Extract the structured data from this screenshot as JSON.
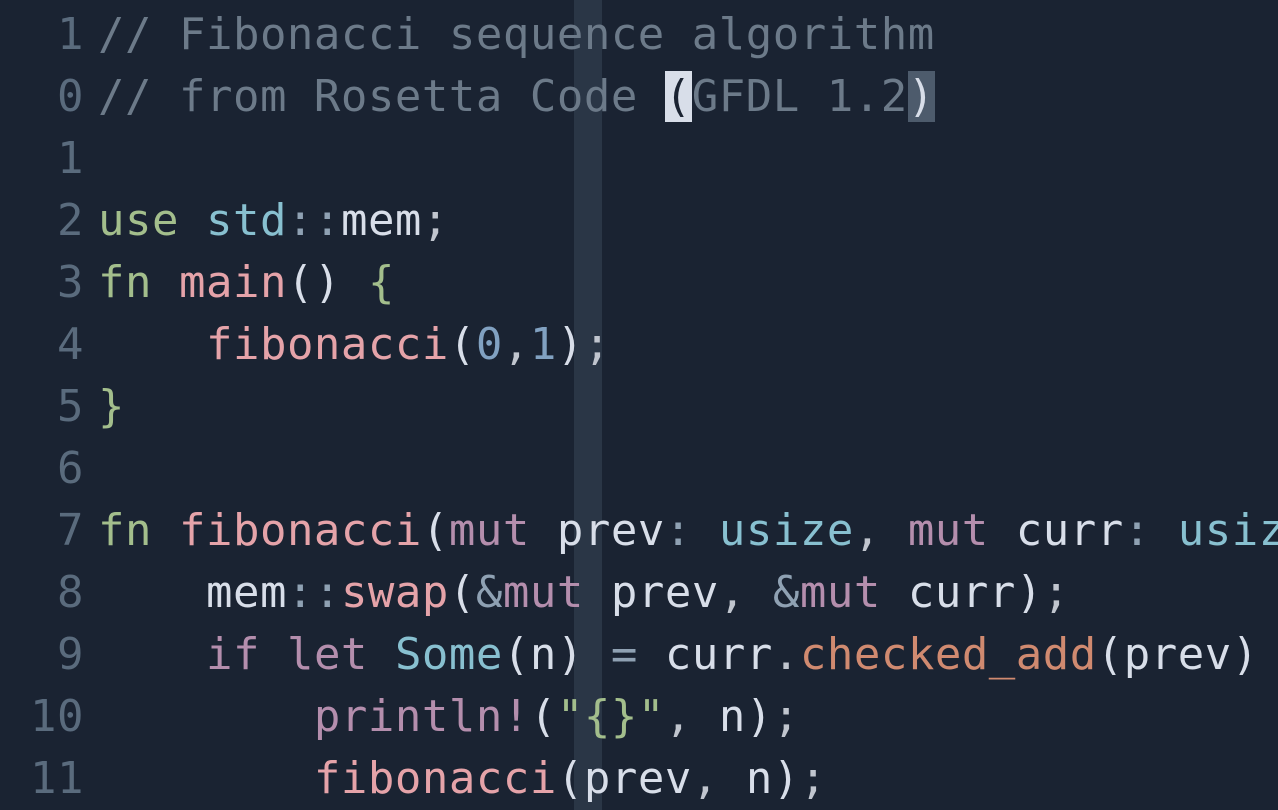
{
  "editor": {
    "lines": [
      {
        "num": "1",
        "tokens": [
          {
            "cls": "tok-comment",
            "t": "// Fibonacci sequence algorithm"
          }
        ]
      },
      {
        "num": "0",
        "tokens": [
          {
            "cls": "tok-comment",
            "t": "// from Rosetta Code "
          },
          {
            "cls": "cursor-match",
            "t": "("
          },
          {
            "cls": "tok-comment",
            "t": "GFDL 1.2"
          },
          {
            "cls": "paren-match",
            "t": ")"
          }
        ]
      },
      {
        "num": "1",
        "tokens": []
      },
      {
        "num": "2",
        "tokens": [
          {
            "cls": "tok-keyword",
            "t": "use"
          },
          {
            "cls": "",
            "t": " "
          },
          {
            "cls": "tok-type",
            "t": "std"
          },
          {
            "cls": "tok-op",
            "t": "::"
          },
          {
            "cls": "tok-ident",
            "t": "mem"
          },
          {
            "cls": "tok-punct",
            "t": ";"
          }
        ]
      },
      {
        "num": "3",
        "tokens": [
          {
            "cls": "tok-keyword",
            "t": "fn"
          },
          {
            "cls": "",
            "t": " "
          },
          {
            "cls": "tok-fn",
            "t": "main"
          },
          {
            "cls": "tok-paren",
            "t": "()"
          },
          {
            "cls": "",
            "t": " "
          },
          {
            "cls": "tok-brace",
            "t": "{"
          }
        ]
      },
      {
        "num": "4",
        "tokens": [
          {
            "cls": "",
            "t": "    "
          },
          {
            "cls": "tok-fn",
            "t": "fibonacci"
          },
          {
            "cls": "tok-paren",
            "t": "("
          },
          {
            "cls": "tok-num",
            "t": "0"
          },
          {
            "cls": "tok-punct",
            "t": ","
          },
          {
            "cls": "tok-num",
            "t": "1"
          },
          {
            "cls": "tok-paren",
            "t": ")"
          },
          {
            "cls": "tok-punct",
            "t": ";"
          }
        ]
      },
      {
        "num": "5",
        "tokens": [
          {
            "cls": "tok-brace",
            "t": "}"
          }
        ]
      },
      {
        "num": "6",
        "tokens": []
      },
      {
        "num": "7",
        "tokens": [
          {
            "cls": "tok-keyword",
            "t": "fn"
          },
          {
            "cls": "",
            "t": " "
          },
          {
            "cls": "tok-fn",
            "t": "fibonacci"
          },
          {
            "cls": "tok-paren",
            "t": "("
          },
          {
            "cls": "tok-keyword2",
            "t": "mut"
          },
          {
            "cls": "",
            "t": " "
          },
          {
            "cls": "tok-ident",
            "t": "prev"
          },
          {
            "cls": "tok-op",
            "t": ":"
          },
          {
            "cls": "",
            "t": " "
          },
          {
            "cls": "tok-type",
            "t": "usize"
          },
          {
            "cls": "tok-punct",
            "t": ","
          },
          {
            "cls": "",
            "t": " "
          },
          {
            "cls": "tok-keyword2",
            "t": "mut"
          },
          {
            "cls": "",
            "t": " "
          },
          {
            "cls": "tok-ident",
            "t": "curr"
          },
          {
            "cls": "tok-op",
            "t": ":"
          },
          {
            "cls": "",
            "t": " "
          },
          {
            "cls": "tok-type",
            "t": "usiz"
          }
        ]
      },
      {
        "num": "8",
        "tokens": [
          {
            "cls": "",
            "t": "    "
          },
          {
            "cls": "tok-ident",
            "t": "mem"
          },
          {
            "cls": "tok-op",
            "t": "::"
          },
          {
            "cls": "tok-fn",
            "t": "swap"
          },
          {
            "cls": "tok-paren",
            "t": "("
          },
          {
            "cls": "tok-op",
            "t": "&"
          },
          {
            "cls": "tok-keyword2",
            "t": "mut"
          },
          {
            "cls": "",
            "t": " "
          },
          {
            "cls": "tok-ident",
            "t": "prev"
          },
          {
            "cls": "tok-punct",
            "t": ","
          },
          {
            "cls": "",
            "t": " "
          },
          {
            "cls": "tok-op",
            "t": "&"
          },
          {
            "cls": "tok-keyword2",
            "t": "mut"
          },
          {
            "cls": "",
            "t": " "
          },
          {
            "cls": "tok-ident",
            "t": "curr"
          },
          {
            "cls": "tok-paren",
            "t": ")"
          },
          {
            "cls": "tok-punct",
            "t": ";"
          }
        ]
      },
      {
        "num": "9",
        "tokens": [
          {
            "cls": "",
            "t": "    "
          },
          {
            "cls": "tok-keyword2",
            "t": "if"
          },
          {
            "cls": "",
            "t": " "
          },
          {
            "cls": "tok-keyword2",
            "t": "let"
          },
          {
            "cls": "",
            "t": " "
          },
          {
            "cls": "tok-type",
            "t": "Some"
          },
          {
            "cls": "tok-paren",
            "t": "("
          },
          {
            "cls": "tok-ident",
            "t": "n"
          },
          {
            "cls": "tok-paren",
            "t": ")"
          },
          {
            "cls": "",
            "t": " "
          },
          {
            "cls": "tok-op",
            "t": "="
          },
          {
            "cls": "",
            "t": " "
          },
          {
            "cls": "tok-ident",
            "t": "curr"
          },
          {
            "cls": "tok-punct",
            "t": "."
          },
          {
            "cls": "tok-fn2",
            "t": "checked_add"
          },
          {
            "cls": "tok-paren",
            "t": "("
          },
          {
            "cls": "tok-ident",
            "t": "prev"
          },
          {
            "cls": "tok-paren",
            "t": ")"
          }
        ]
      },
      {
        "num": "10",
        "tokens": [
          {
            "cls": "",
            "t": "        "
          },
          {
            "cls": "tok-macro",
            "t": "println!"
          },
          {
            "cls": "tok-paren",
            "t": "("
          },
          {
            "cls": "tok-string",
            "t": "\"{}\""
          },
          {
            "cls": "tok-punct",
            "t": ","
          },
          {
            "cls": "",
            "t": " "
          },
          {
            "cls": "tok-ident",
            "t": "n"
          },
          {
            "cls": "tok-paren",
            "t": ")"
          },
          {
            "cls": "tok-punct",
            "t": ";"
          }
        ]
      },
      {
        "num": "11",
        "tokens": [
          {
            "cls": "",
            "t": "        "
          },
          {
            "cls": "tok-fn",
            "t": "fibonacci"
          },
          {
            "cls": "tok-paren",
            "t": "("
          },
          {
            "cls": "tok-ident",
            "t": "prev"
          },
          {
            "cls": "tok-punct",
            "t": ","
          },
          {
            "cls": "",
            "t": " "
          },
          {
            "cls": "tok-ident",
            "t": "n"
          },
          {
            "cls": "tok-paren",
            "t": ")"
          },
          {
            "cls": "tok-punct",
            "t": ";"
          }
        ]
      }
    ]
  }
}
